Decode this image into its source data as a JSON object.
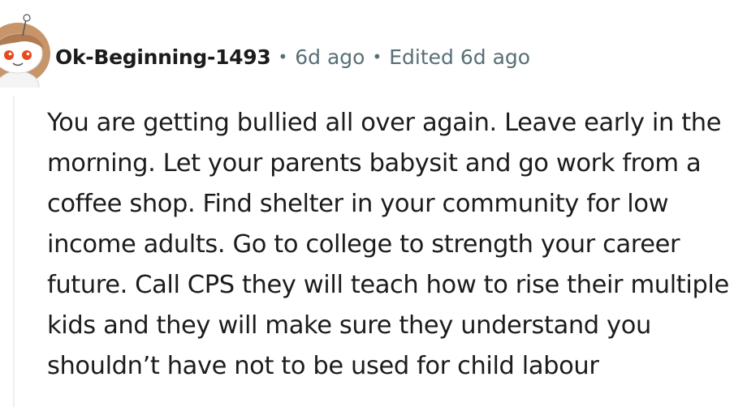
{
  "comment": {
    "avatar_icon": "snoo-avatar-icon",
    "author": "Ok-Beginning-1493",
    "separator": "•",
    "age": "6d ago",
    "edited": "Edited 6d ago",
    "text": "You are getting bullied all over again. Leave early in the morning. Let your parents babysit and go work from a coffee shop. Find shelter in your community for low income adults. Go to college to strength your career future. Call CPS they will teach how to rise their multiple kids and they will make sure they understand you shouldn’t have not to be used for child labour"
  },
  "colors": {
    "text": "#1c1c1c",
    "meta": "#576f76",
    "thread_line": "#edeff1",
    "avatar_hair": "#c8956b",
    "avatar_eye": "#e8491f"
  }
}
